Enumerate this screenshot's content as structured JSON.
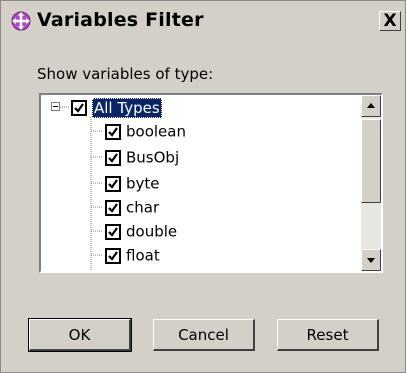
{
  "window": {
    "title": "Variables Filter",
    "close_label": "X",
    "icon": "filter-icon"
  },
  "filter": {
    "label": "Show variables of type:",
    "root": {
      "label": "All Types",
      "checked": true,
      "expanded": true,
      "selected": true
    },
    "items": [
      {
        "label": "boolean",
        "checked": true
      },
      {
        "label": "BusObj",
        "checked": true
      },
      {
        "label": "byte",
        "checked": true
      },
      {
        "label": "char",
        "checked": true
      },
      {
        "label": "double",
        "checked": true
      },
      {
        "label": "float",
        "checked": true
      }
    ]
  },
  "buttons": {
    "ok": "OK",
    "cancel": "Cancel",
    "reset": "Reset"
  },
  "colors": {
    "background": "#d4d0c8",
    "selection": "#0a246a"
  }
}
